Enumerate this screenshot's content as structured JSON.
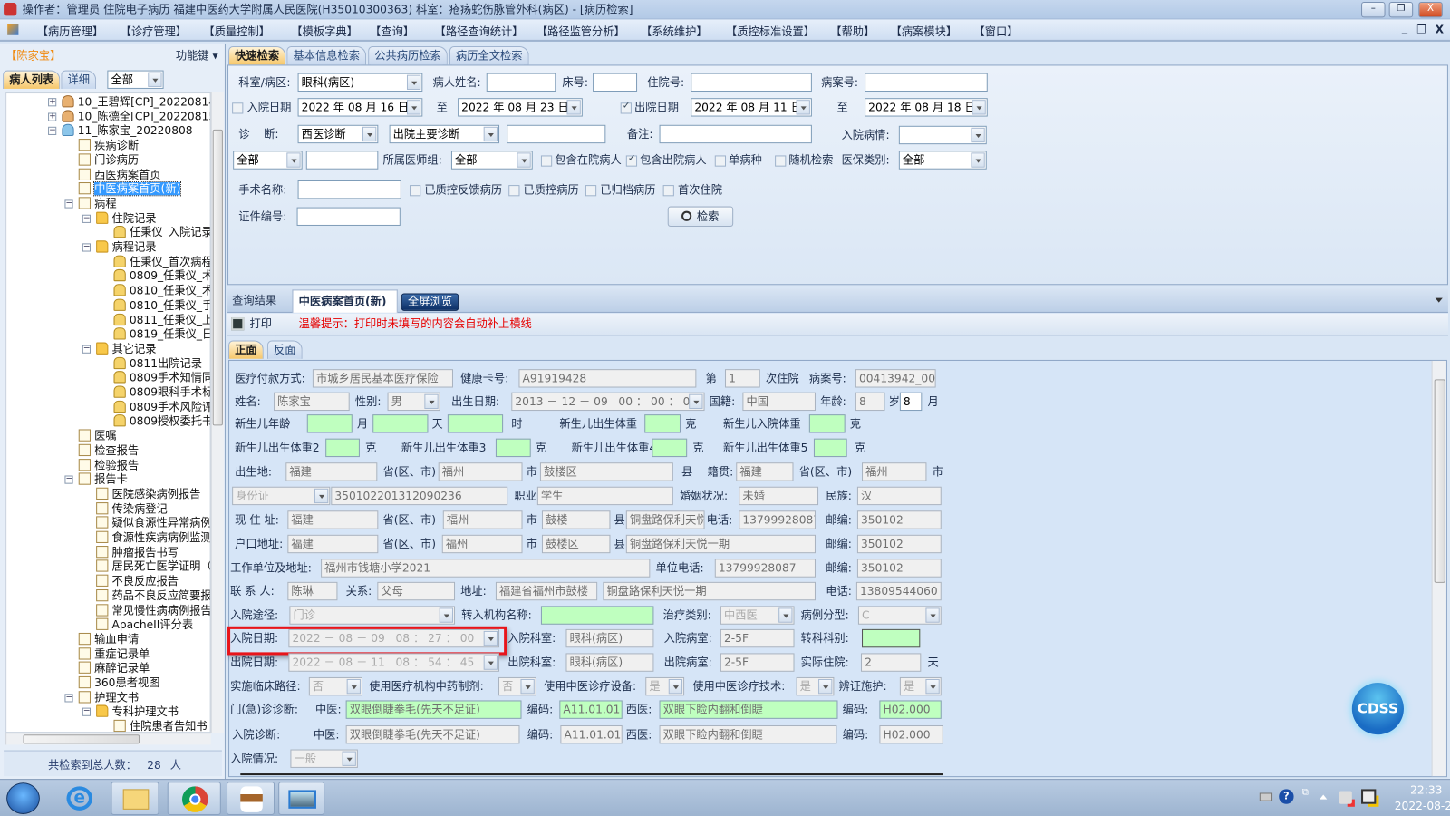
{
  "titlebar": {
    "text": "操作者：管理员 住院电子病历  福建中医药大学附属人民医院(H35010300363)  科室：疮疡蛇伤脉管外科(病区) - [病历检索]",
    "minimize": "–",
    "restore": "❐",
    "close": "X"
  },
  "menu": {
    "items": [
      "【病历管理】",
      "【诊疗管理】",
      "【质量控制】",
      "【模板字典】",
      "【查询】",
      "【路径查询统计】",
      "【路径监管分析】",
      "【系统维护】",
      "【质控标准设置】",
      "【帮助】",
      "【病案模块】",
      "【窗口】"
    ],
    "mdi_min": "_",
    "mdi_restore": "❐",
    "mdi_close": "X"
  },
  "left": {
    "patient": "【陈家宝】",
    "function_key": "功能键 ▾",
    "tabs": [
      "病人列表",
      "详细"
    ],
    "filter": "全部",
    "status_prefix": "共检索到总人数：",
    "status_count": "28",
    "status_unit": "人",
    "tree": [
      {
        "label": "10_王碧辉[CP]_20220814",
        "level": 0,
        "icon": "person-female",
        "exp": "+"
      },
      {
        "label": "10_陈德全[CP]_20220815",
        "level": 0,
        "icon": "person-female",
        "exp": "+"
      },
      {
        "label": "11_陈家宝_20220808",
        "level": 0,
        "icon": "person-male",
        "exp": "-"
      },
      {
        "label": "疾病诊断",
        "level": 1,
        "icon": "doc"
      },
      {
        "label": "门诊病历",
        "level": 1,
        "icon": "book"
      },
      {
        "label": "西医病案首页",
        "level": 1,
        "icon": "doc"
      },
      {
        "label": "中医病案首页(新)",
        "level": 1,
        "icon": "doc",
        "selected": true
      },
      {
        "label": "病程",
        "level": 1,
        "icon": "doc",
        "exp": "-"
      },
      {
        "label": "住院记录",
        "level": 2,
        "icon": "folder",
        "exp": "-"
      },
      {
        "label": "任秉仪_入院记录",
        "level": 3,
        "icon": "lock"
      },
      {
        "label": "病程记录",
        "level": 2,
        "icon": "folder",
        "exp": "-"
      },
      {
        "label": "任秉仪_首次病程",
        "level": 3,
        "icon": "lock"
      },
      {
        "label": "0809_任秉仪_术",
        "level": 3,
        "icon": "lock"
      },
      {
        "label": "0810_任秉仪_术",
        "level": 3,
        "icon": "lock"
      },
      {
        "label": "0810_任秉仪_手",
        "level": 3,
        "icon": "lock"
      },
      {
        "label": "0811_任秉仪_上",
        "level": 3,
        "icon": "lock"
      },
      {
        "label": "0819_任秉仪_日",
        "level": 3,
        "icon": "lock"
      },
      {
        "label": "其它记录",
        "level": 2,
        "icon": "folder",
        "exp": "-"
      },
      {
        "label": "0811出院记录",
        "level": 3,
        "icon": "lock"
      },
      {
        "label": "0809手术知情同",
        "level": 3,
        "icon": "lock"
      },
      {
        "label": "0809眼科手术标",
        "level": 3,
        "icon": "lock"
      },
      {
        "label": "0809手术风险评",
        "level": 3,
        "icon": "lock"
      },
      {
        "label": "0809授权委托书",
        "level": 3,
        "icon": "lock"
      },
      {
        "label": "医嘱",
        "level": 1,
        "icon": "doc"
      },
      {
        "label": "检查报告",
        "level": 1,
        "icon": "doc"
      },
      {
        "label": "检验报告",
        "level": 1,
        "icon": "doc"
      },
      {
        "label": "报告卡",
        "level": 1,
        "icon": "doc",
        "exp": "-"
      },
      {
        "label": "医院感染病例报告",
        "level": 2,
        "icon": "doc"
      },
      {
        "label": "传染病登记",
        "level": 2,
        "icon": "doc"
      },
      {
        "label": "疑似食源性异常病例",
        "level": 2,
        "icon": "doc"
      },
      {
        "label": "食源性疾病病例监测",
        "level": 2,
        "icon": "doc"
      },
      {
        "label": "肿瘤报告书写",
        "level": 2,
        "icon": "doc"
      },
      {
        "label": "居民死亡医学证明（",
        "level": 2,
        "icon": "doc"
      },
      {
        "label": "不良反应报告",
        "level": 2,
        "icon": "doc"
      },
      {
        "label": "药品不良反应简要报",
        "level": 2,
        "icon": "doc"
      },
      {
        "label": "常见慢性病病例报告",
        "level": 2,
        "icon": "doc"
      },
      {
        "label": "ApacheII评分表",
        "level": 2,
        "icon": "doc"
      },
      {
        "label": "输血申请",
        "level": 1,
        "icon": "doc"
      },
      {
        "label": "重症记录单",
        "level": 1,
        "icon": "doc"
      },
      {
        "label": "麻醉记录单",
        "level": 1,
        "icon": "doc"
      },
      {
        "label": "360患者视图",
        "level": 1,
        "icon": "doc"
      },
      {
        "label": "护理文书",
        "level": 1,
        "icon": "doc",
        "exp": "-"
      },
      {
        "label": "专科护理文书",
        "level": 2,
        "icon": "folder",
        "exp": "-"
      },
      {
        "label": "住院患者告知书",
        "level": 3,
        "icon": "doc"
      }
    ]
  },
  "search": {
    "tabs": [
      "快速检索",
      "基本信息检索",
      "公共病历检索",
      "病历全文检索"
    ],
    "dept_label": "科室/病区:",
    "dept": "眼科(病区)",
    "name_label": "病人姓名:",
    "bed_label": "床号:",
    "inpatient_no_label": "住院号:",
    "case_no_label": "病案号:",
    "admit_date_label": "入院日期",
    "admit_from": "2022 年 08 月 16 日",
    "to1": "至",
    "admit_to": "2022 年 08 月 23 日",
    "discharge_date_label": "出院日期",
    "discharge_from": "2022 年 08 月 11 日",
    "to2": "至",
    "discharge_to": "2022 年 08 月 18 日",
    "diag_label": "诊    断:",
    "diag_type": "西医诊断",
    "diag_kind": "出院主要诊断",
    "remark_label": "备注:",
    "condition_label": "入院病情:",
    "scope": "全部",
    "doctor_group_label": "所属医师组:",
    "doctor_group": "全部",
    "cb_inpatient": "包含在院病人",
    "cb_discharged": "包含出院病人",
    "cb_single": "单病种",
    "cb_random": "随机检索",
    "insurance_label": "医保类别:",
    "insurance": "全部",
    "surgery_label": "手术名称:",
    "cb_feedback": "已质控反馈病历",
    "cb_qc": "已质控病历",
    "cb_archived": "已归档病历",
    "cb_first": "首次住院",
    "id_label": "证件编号:",
    "search_button": "检索"
  },
  "result": {
    "tabs": [
      "查询结果",
      "中医病案首页(新)"
    ],
    "fullscreen": "全屏浏览",
    "print": "打印",
    "tip": "温馨提示：打印时未填写的内容会自动补上横线",
    "sides": [
      "正面",
      "反面"
    ]
  },
  "form": {
    "pay_label": "医疗付款方式:",
    "pay": "市城乡居民基本医疗保险",
    "card_label": "健康卡号:",
    "card": "A91919428",
    "nth_label": "第",
    "nth": "1",
    "nth_suffix": "次住院",
    "case_label": "病案号:",
    "case": "00413942_001",
    "name_label": "姓名:",
    "name": "陈家宝",
    "sex_label": "性别:",
    "sex": "男",
    "birth_label": "出生日期:",
    "birth": "2013 － 12 － 09   00 ： 00 ： 00",
    "nation_label": "国籍:",
    "nation": "中国",
    "age_label": "年龄:",
    "age": "8",
    "age_unit": "岁",
    "age_month": "8",
    "month_unit": "月",
    "nb_age_label": "新生儿年龄",
    "u_month": "月",
    "u_day": "天",
    "u_hour": "时",
    "nb_w1_label": "新生儿出生体重",
    "g": "克",
    "nb_admit_w_label": "新生儿入院体重",
    "nb_w2_label": "新生儿出生体重2",
    "nb_w3_label": "新生儿出生体重3",
    "nb_w4_label": "新生儿出生体重4",
    "nb_w5_label": "新生儿出生体重5",
    "birthplace_label": "出生地:",
    "prov_label": "省(区、市)",
    "city_label": "市",
    "county_label": "县",
    "birth_prov": "福建",
    "birth_city": "福州",
    "birth_county": "鼓楼区",
    "native_label": "籍贯:",
    "native_prov": "福建",
    "native_city": "福州",
    "id_type": "身份证",
    "id_no": "350102201312090236",
    "job_label": "职业:",
    "job": "学生",
    "marital_label": "婚姻状况:",
    "marital": "未婚",
    "ethnic_label": "民族:",
    "ethnic": "汉",
    "cur_label": "现 住 址:",
    "cur_prov": "福建",
    "cur_city": "福州",
    "cur_county": "鼓楼",
    "cur_street": "铜盘路保利天悦一期",
    "phone_label": "电话:",
    "cur_phone": "13799928087",
    "zip_label": "邮编:",
    "cur_zip": "350102",
    "hukou_label": "户口地址:",
    "hk_prov": "福建",
    "hk_city": "福州",
    "hk_county": "鼓楼区",
    "hk_street": "铜盘路保利天悦一期",
    "hk_zip": "350102",
    "work_label": "工作单位及地址:",
    "work": "福州市钱塘小学2021",
    "work_phone_label": "单位电话:",
    "work_phone": "13799928087",
    "work_zip": "350102",
    "contact_label": "联 系 人:",
    "contact": "陈琳",
    "relation_label": "关系:",
    "relation": "父母",
    "addr_label": "地址:",
    "contact_addr1": "福建省福州市鼓楼",
    "contact_addr2": "铜盘路保利天悦一期",
    "contact_phone": "13809544060",
    "route_label": "入院途径:",
    "route": "门诊",
    "transfer_org_label": "转入机构名称:",
    "treat_label": "治疗类别:",
    "treat": "中西医",
    "case_type_label": "病例分型:",
    "case_type": "C",
    "admit_label": "入院日期:",
    "admit": "2022 － 08 － 09   08 ： 27 ： 00",
    "admit_dept_label": "入院科室:",
    "admit_dept": "眼科(病区)",
    "admit_ward_label": "入院病室:",
    "admit_ward": "2-5F",
    "transfer_label": "转科科别:",
    "dis_label": "出院日期:",
    "dis": "2022 － 08 － 11   08 ： 54 ： 45",
    "dis_dept_label": "出院科室:",
    "dis_dept": "眼科(病区)",
    "dis_ward_label": "出院病室:",
    "dis_ward": "2-5F",
    "los_label": "实际住院:",
    "los": "2",
    "los_unit": "天",
    "path_label": "实施临床路径:",
    "path": "否",
    "herb_label": "使用医疗机构中药制剂:",
    "herb": "否",
    "equip_label": "使用中医诊疗设备:",
    "equip": "是",
    "tech_label": "使用中医诊疗技术:",
    "tech": "是",
    "nursing_label": "辨证施护:",
    "nursing": "是",
    "op_diag_label": "门(急)诊诊断:",
    "tcm_label": "中医:",
    "code_label": "编码:",
    "wm_label": "西医:",
    "op_tcm": "双眼倒睫拳毛(先天不足证)",
    "op_tcm_code": "A11.01.01",
    "op_wm": "双眼下睑内翻和倒睫",
    "op_wm_code": "H02.000",
    "ad_diag_label": "入院诊断:",
    "ad_tcm": "双眼倒睫拳毛(先天不足证)",
    "ad_tcm_code": "A11.01.01",
    "ad_wm": "双眼下睑内翻和倒睫",
    "ad_wm_code": "H02.000",
    "ad_cond_label": "入院情况:",
    "ad_cond": "一般"
  },
  "cdss": "CDSS",
  "taskbar": {
    "time": "22:33",
    "date": "2022-08-23"
  },
  "colors": {
    "highlight": "#e8141a",
    "accent_tab": "#f6c76a",
    "green_field": "#bfffbf",
    "tip": "#e60000"
  }
}
